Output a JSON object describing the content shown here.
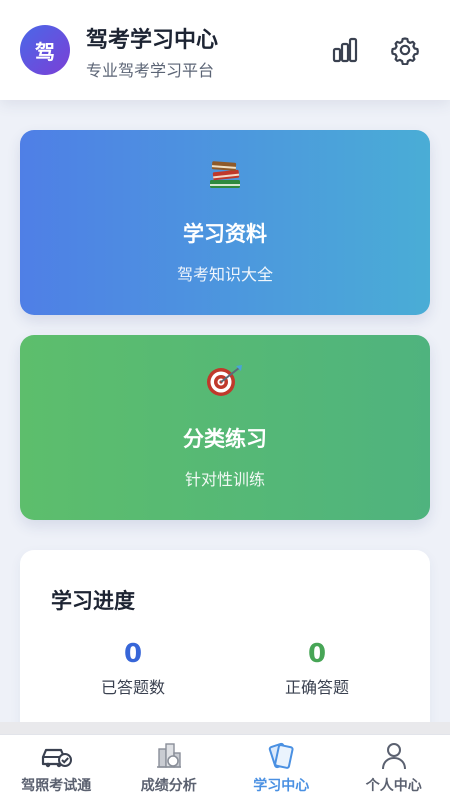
{
  "header": {
    "logo_char": "驾",
    "title": "驾考学习中心",
    "subtitle": "专业驾考学习平台",
    "icons": [
      "bar-chart-icon",
      "gear-icon"
    ]
  },
  "cards": [
    {
      "emoji": "📚",
      "title": "学习资料",
      "subtitle": "驾考知识大全"
    },
    {
      "emoji": "🎯",
      "title": "分类练习",
      "subtitle": "针对性训练"
    }
  ],
  "progress": {
    "title": "学习进度",
    "stats": [
      {
        "value": "0",
        "label": "已答题数"
      },
      {
        "value": "0",
        "label": "正确答题"
      }
    ]
  },
  "tabbar": {
    "active": 2,
    "tabs": [
      {
        "label": "驾照考试通",
        "icon": "car-check-icon"
      },
      {
        "label": "成绩分析",
        "icon": "buildings-chart-icon"
      },
      {
        "label": "学习中心",
        "icon": "cards-icon"
      },
      {
        "label": "个人中心",
        "icon": "person-icon"
      }
    ]
  },
  "colors": {
    "accent": "#4a90e2",
    "card_blue_start": "#4f7fe6",
    "card_blue_end": "#4aadd6",
    "card_green_start": "#5dbe6c",
    "card_green_end": "#4fb37e",
    "answered_color": "#3766d8",
    "correct_color": "#47a556"
  }
}
